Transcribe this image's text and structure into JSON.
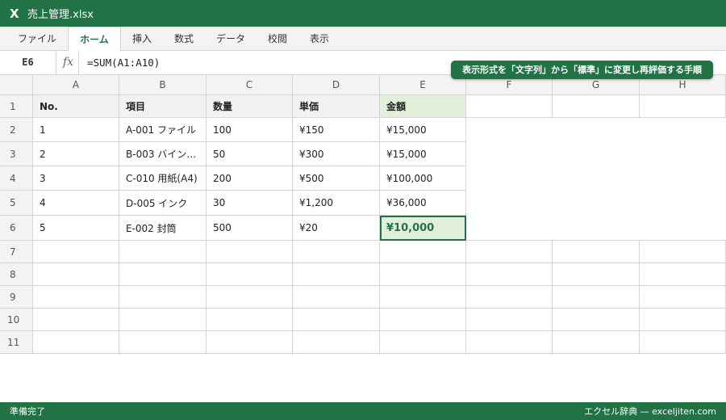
{
  "window": {
    "app_icon": "X",
    "title": "売上管理.xlsx"
  },
  "ribbon": {
    "tabs": [
      "ファイル",
      "ホーム",
      "挿入",
      "数式",
      "データ",
      "校閲",
      "表示"
    ],
    "active_tab": "ホーム"
  },
  "formula_bar": {
    "name_box": "E6",
    "fx_label": "fx",
    "formula": "=SUM(A1:A10)"
  },
  "tip": "表示形式を「文字列」から「標準」に変更し再評価する手順",
  "sheet": {
    "columns": [
      "A",
      "B",
      "C",
      "D",
      "E",
      "F",
      "G",
      "H"
    ],
    "rows": [
      "1",
      "2",
      "3",
      "4",
      "5",
      "6",
      "7",
      "8",
      "9",
      "10",
      "11"
    ],
    "headers": [
      "No.",
      "項目",
      "数量",
      "単価",
      "金額"
    ],
    "data": [
      [
        "1",
        "A-001 ファイル",
        "100",
        "¥150",
        "¥15,000"
      ],
      [
        "2",
        "B-003 バイン…",
        "50",
        "¥300",
        "¥15,000"
      ],
      [
        "3",
        "C-010 用紙(A4)",
        "200",
        "¥500",
        "¥100,000"
      ],
      [
        "4",
        "D-005 インク",
        "30",
        "¥1,200",
        "¥36,000"
      ],
      [
        "5",
        "E-002 封筒",
        "500",
        "¥20",
        "¥10,000"
      ]
    ],
    "selected_cell": "E6"
  },
  "status": {
    "left": "準備完了",
    "right": "エクセル辞典 — exceljiten.com"
  },
  "colors": {
    "accent": "#217346",
    "highlight": "#e2efda",
    "grid_line": "#d4d4d4",
    "header_bg": "#f3f3f3"
  }
}
